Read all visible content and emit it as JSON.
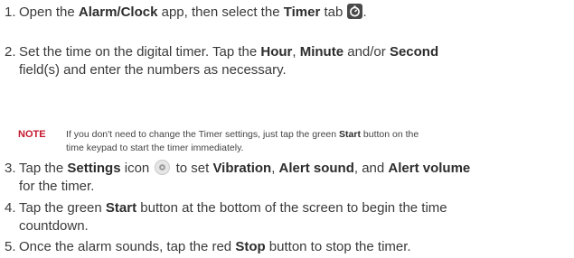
{
  "steps": [
    {
      "num": "1.",
      "p1": "Open the ",
      "b1": "Alarm/Clock",
      "p2": " app, then select the ",
      "b2": "Timer",
      "p3": " tab ",
      "p4": ".",
      "icon": "timer-icon"
    },
    {
      "num": "2.",
      "p1": "Set the time on the digital timer. Tap the ",
      "b1": "Hour",
      "p2": ", ",
      "b2": "Minute",
      "p3": " and/or ",
      "b3": "Second",
      "line2": "field(s) and enter the numbers as necessary."
    },
    {
      "num": "3.",
      "p1": "Tap the ",
      "b1": "Settings",
      "p2": " icon ",
      "p3": " to set ",
      "b2": "Vibration",
      "p4": ", ",
      "b3": "Alert sound",
      "p5": ", and ",
      "b4": "Alert volume",
      "line2": "for the timer.",
      "icon": "gear-icon"
    },
    {
      "num": "4.",
      "p1": "Tap the green ",
      "b1": "Start",
      "p2": " button at the bottom of the screen to begin the time",
      "line2": "countdown."
    },
    {
      "num": "5.",
      "p1": "Once the alarm sounds, tap the red ",
      "b1": "Stop",
      "p2": " button to stop the timer."
    }
  ],
  "note": {
    "label": "NOTE",
    "t1": "If you don't need to change the Timer settings, just tap the green ",
    "b1": "Start",
    "t2": " button on the",
    "line2": "time keypad to start the timer immediately.",
    "label_color": "#c4182f"
  }
}
